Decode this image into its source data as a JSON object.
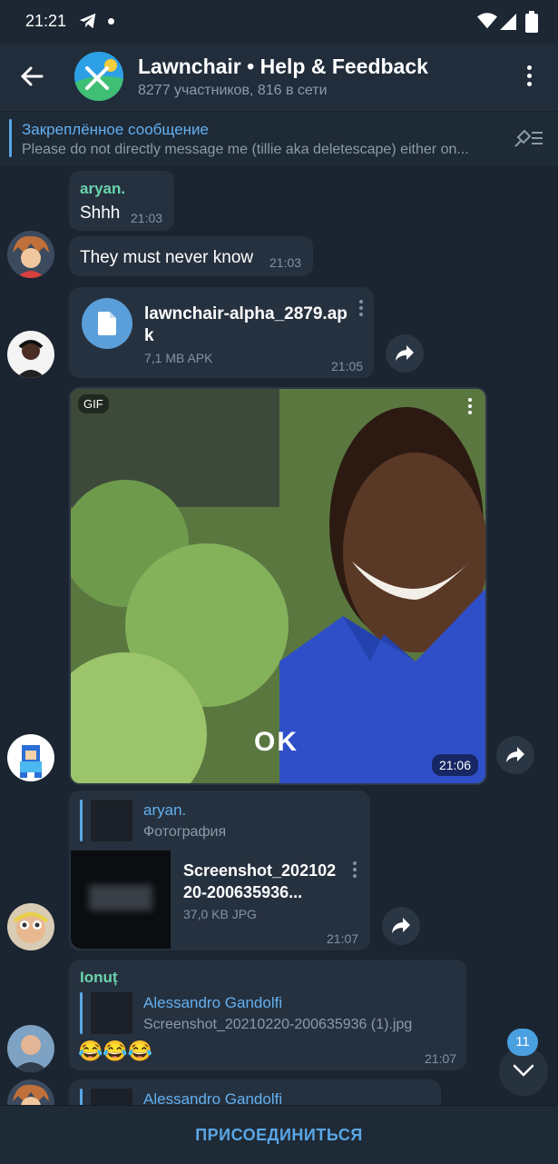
{
  "status_bar": {
    "time": "21:21"
  },
  "header": {
    "title": "Lawnchair • Help & Feedback",
    "subtitle": "8277 участников, 816 в сети"
  },
  "pinned": {
    "title": "Закреплённое сообщение",
    "text": "Please do not directly message me (tillie aka deletescape) either on..."
  },
  "messages": [
    {
      "sender": "aryan.",
      "text": "Shhh",
      "time": "21:03"
    },
    {
      "text": "They must never know",
      "time": "21:03"
    },
    {
      "file_name": "lawnchair-alpha_2879.apk",
      "file_size": "7,1 MB APK",
      "time": "21:05"
    },
    {
      "gif_label": "GIF",
      "gif_caption": "OK",
      "time": "21:06"
    },
    {
      "reply_to": "aryan.",
      "reply_text": "Фотография",
      "file_name": "Screenshot_20210220-200635936...",
      "file_size": "37,0 KB JPG",
      "time": "21:07"
    },
    {
      "sender": "Ionuț",
      "reply_to": "Alessandro Gandolfi",
      "reply_text": "Screenshot_20210220-200635936 (1).jpg",
      "text": "😂😂😂",
      "time": "21:07"
    },
    {
      "reply_to": "Alessandro Gandolfi"
    }
  ],
  "scroll": {
    "unread": "11"
  },
  "footer": {
    "join_label": "ПРИСОЕДИНИТЬСЯ"
  }
}
